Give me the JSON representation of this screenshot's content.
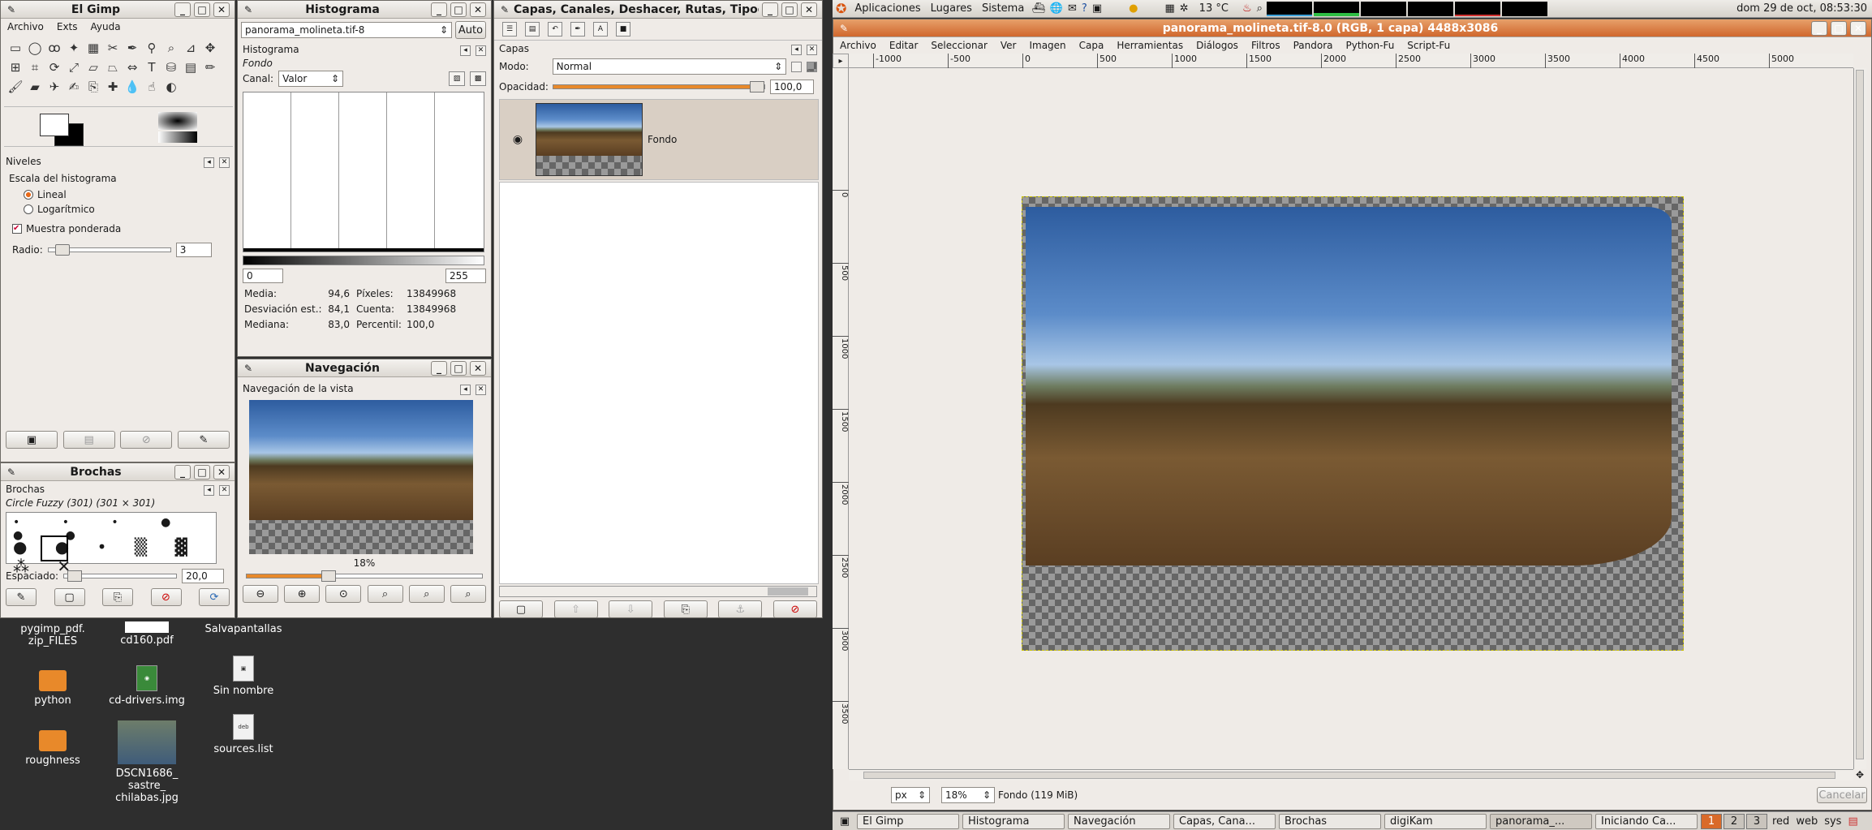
{
  "desktop": {
    "items": [
      {
        "label": "pygimp_pdf.\nzip_FILES",
        "type": "folder"
      },
      {
        "label": "cd160.pdf",
        "type": "file"
      },
      {
        "label": "Salvapantallas",
        "type": "file"
      },
      {
        "label": "python",
        "type": "folder"
      },
      {
        "label": "cd-drivers.img",
        "type": "file"
      },
      {
        "label": "Sin nombre",
        "type": "file"
      },
      {
        "label": "roughness",
        "type": "folder"
      },
      {
        "label": "DSCN1686_\nsastre_\nchilabas.jpg",
        "type": "image"
      },
      {
        "label": "sources.list",
        "type": "file"
      }
    ]
  },
  "toolbox": {
    "title": "El Gimp",
    "menu": [
      "Archivo",
      "Exts",
      "Ayuda"
    ]
  },
  "levels": {
    "title": "Niveles",
    "scale_label": "Escala del histograma",
    "opt_linear": "Lineal",
    "opt_log": "Logarítmico",
    "weighted": "Muestra ponderada",
    "radius_label": "Radio:",
    "radius_value": "3"
  },
  "brushes": {
    "title": "Brochas",
    "section": "Brochas",
    "brush_name": "Circle Fuzzy (301) (301 × 301)",
    "spacing_label": "Espaciado:",
    "spacing_value": "20,0"
  },
  "histogram": {
    "title": "Histograma",
    "image_select": "panorama_molineta.tif-8",
    "auto": "Auto",
    "section": "Histograma",
    "layer": "Fondo",
    "channel_label": "Canal:",
    "channel_value": "Valor",
    "range_min": "0",
    "range_max": "255",
    "stats": [
      {
        "label": "Media:",
        "value": "94,6"
      },
      {
        "label": "Píxeles:",
        "value": "13849968"
      },
      {
        "label": "Desviación est.:",
        "value": "84,1"
      },
      {
        "label": "Cuenta:",
        "value": "13849968"
      },
      {
        "label": "Mediana:",
        "value": "83,0"
      },
      {
        "label": "Percentil:",
        "value": "100,0"
      }
    ]
  },
  "navigation": {
    "title": "Navegación",
    "section": "Navegación de la vista",
    "zoom": "18%"
  },
  "layers": {
    "title": "Capas, Canales, Deshacer, Rutas, Tipog",
    "section": "Capas",
    "mode_label": "Modo:",
    "mode_value": "Normal",
    "opacity_label": "Opacidad:",
    "opacity_value": "100,0",
    "layer_name": "Fondo"
  },
  "topbar": {
    "menus": [
      "Aplicaciones",
      "Lugares",
      "Sistema"
    ],
    "temp": "13 °C",
    "clock": "dom 29 de oct, 08:53:30"
  },
  "image_window": {
    "title": "panorama_molineta.tif-8.0 (RGB, 1 capa) 4488x3086",
    "menu": [
      "Archivo",
      "Editar",
      "Seleccionar",
      "Ver",
      "Imagen",
      "Capa",
      "Herramientas",
      "Diálogos",
      "Filtros",
      "Pandora",
      "Python-Fu",
      "Script-Fu"
    ],
    "ruler_h": [
      "-1000",
      "-500",
      "0",
      "500",
      "1000",
      "1500",
      "2000",
      "2500",
      "3000",
      "3500",
      "4000",
      "4500",
      "5000"
    ],
    "ruler_v": [
      "0",
      "500",
      "1000",
      "1500",
      "2000",
      "2500",
      "3000",
      "3500"
    ],
    "unit": "px",
    "zoom": "18%",
    "status": "Fondo (119 MiB)",
    "cancel": "Cancelar"
  },
  "taskbar": {
    "tasks": [
      "El Gimp",
      "Histograma",
      "Navegación",
      "Capas, Cana...",
      "Brochas",
      "digiKam",
      "panorama_...",
      "Iniciando Ca..."
    ],
    "workspaces": [
      "1",
      "2",
      "3"
    ],
    "tray": [
      "red",
      "web",
      "sys"
    ]
  }
}
